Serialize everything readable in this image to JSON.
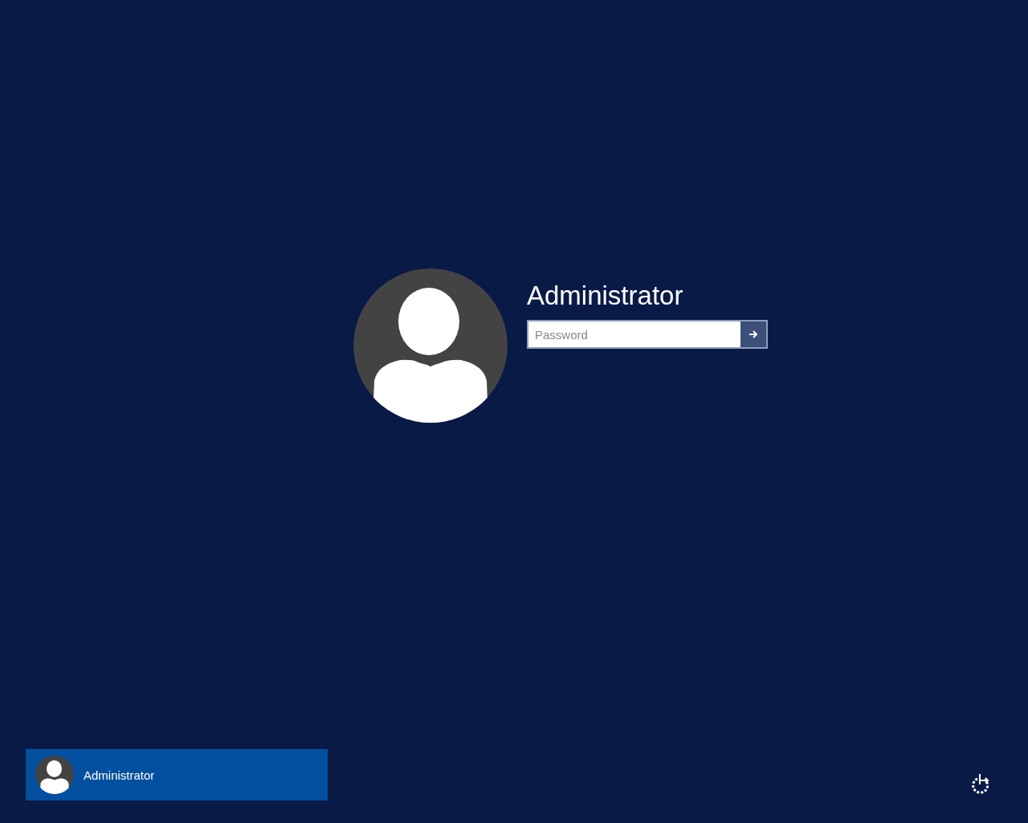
{
  "account": {
    "name": "Administrator",
    "password": {
      "placeholder": "Password"
    }
  },
  "users": [
    {
      "name": "Administrator",
      "selected": true
    }
  ]
}
